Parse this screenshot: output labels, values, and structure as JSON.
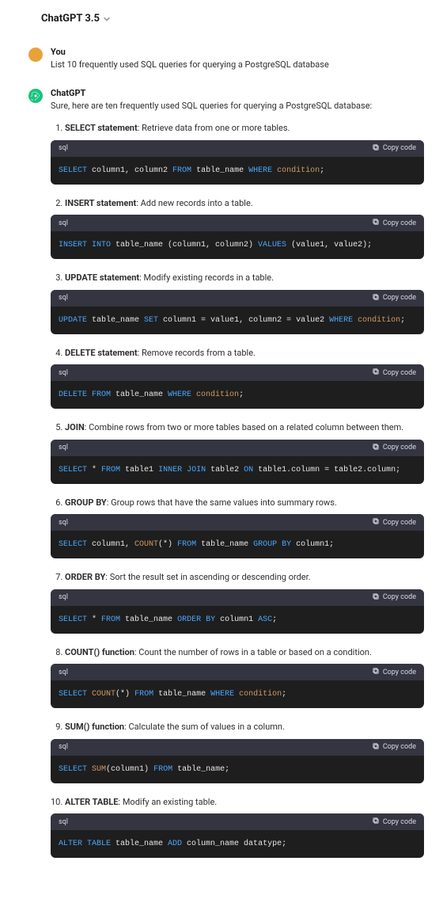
{
  "header": {
    "title": "ChatGPT 3.5"
  },
  "user": {
    "name": "You",
    "text": "List 10 frequently used SQL queries for querying a PostgreSQL database"
  },
  "bot": {
    "name": "ChatGPT",
    "intro": "Sure, here are ten frequently used SQL queries for querying a PostgreSQL database:"
  },
  "code_lang": "sql",
  "copy_label": "Copy code",
  "items": [
    {
      "title": "SELECT statement",
      "desc": ": Retrieve data from one or more tables.",
      "tokens": [
        {
          "t": "SELECT",
          "c": "kw"
        },
        {
          "t": " column1, column2 ",
          "c": "id"
        },
        {
          "t": "FROM",
          "c": "kw"
        },
        {
          "t": " table_name ",
          "c": "id"
        },
        {
          "t": "WHERE",
          "c": "kw"
        },
        {
          "t": " condition",
          "c": "fn"
        },
        {
          "t": ";",
          "c": "id"
        }
      ]
    },
    {
      "title": "INSERT statement",
      "desc": ": Add new records into a table.",
      "tokens": [
        {
          "t": "INSERT INTO",
          "c": "kw"
        },
        {
          "t": " table_name (column1, column2) ",
          "c": "id"
        },
        {
          "t": "VALUES",
          "c": "kw"
        },
        {
          "t": " (value1, value2);",
          "c": "id"
        }
      ]
    },
    {
      "title": "UPDATE statement",
      "desc": ": Modify existing records in a table.",
      "tokens": [
        {
          "t": "UPDATE",
          "c": "kw"
        },
        {
          "t": " table_name ",
          "c": "id"
        },
        {
          "t": "SET",
          "c": "kw"
        },
        {
          "t": " column1 = value1, column2 = value2 ",
          "c": "id"
        },
        {
          "t": "WHERE",
          "c": "kw"
        },
        {
          "t": " condition",
          "c": "fn"
        },
        {
          "t": ";",
          "c": "id"
        }
      ]
    },
    {
      "title": "DELETE statement",
      "desc": ": Remove records from a table.",
      "tokens": [
        {
          "t": "DELETE FROM",
          "c": "kw"
        },
        {
          "t": " table_name ",
          "c": "id"
        },
        {
          "t": "WHERE",
          "c": "kw"
        },
        {
          "t": " condition",
          "c": "fn"
        },
        {
          "t": ";",
          "c": "id"
        }
      ]
    },
    {
      "title": "JOIN",
      "desc": ": Combine rows from two or more tables based on a related column between them.",
      "tokens": [
        {
          "t": "SELECT",
          "c": "kw"
        },
        {
          "t": " * ",
          "c": "id"
        },
        {
          "t": "FROM",
          "c": "kw"
        },
        {
          "t": " table1 ",
          "c": "id"
        },
        {
          "t": "INNER JOIN",
          "c": "kw"
        },
        {
          "t": " table2 ",
          "c": "id"
        },
        {
          "t": "ON",
          "c": "kw"
        },
        {
          "t": " table1.column = table2.column;",
          "c": "id"
        }
      ]
    },
    {
      "title": "GROUP BY",
      "desc": ": Group rows that have the same values into summary rows.",
      "tokens": [
        {
          "t": "SELECT",
          "c": "kw"
        },
        {
          "t": " column1, ",
          "c": "id"
        },
        {
          "t": "COUNT",
          "c": "fn"
        },
        {
          "t": "(*) ",
          "c": "id"
        },
        {
          "t": "FROM",
          "c": "kw"
        },
        {
          "t": " table_name ",
          "c": "id"
        },
        {
          "t": "GROUP BY",
          "c": "kw"
        },
        {
          "t": " column1;",
          "c": "id"
        }
      ]
    },
    {
      "title": "ORDER BY",
      "desc": ": Sort the result set in ascending or descending order.",
      "tokens": [
        {
          "t": "SELECT",
          "c": "kw"
        },
        {
          "t": " * ",
          "c": "id"
        },
        {
          "t": "FROM",
          "c": "kw"
        },
        {
          "t": " table_name ",
          "c": "id"
        },
        {
          "t": "ORDER BY",
          "c": "kw"
        },
        {
          "t": " column1 ",
          "c": "id"
        },
        {
          "t": "ASC",
          "c": "kw"
        },
        {
          "t": ";",
          "c": "id"
        }
      ]
    },
    {
      "title": "COUNT() function",
      "desc": ": Count the number of rows in a table or based on a condition.",
      "tokens": [
        {
          "t": "SELECT",
          "c": "kw"
        },
        {
          "t": " ",
          "c": "id"
        },
        {
          "t": "COUNT",
          "c": "fn"
        },
        {
          "t": "(*) ",
          "c": "id"
        },
        {
          "t": "FROM",
          "c": "kw"
        },
        {
          "t": " table_name ",
          "c": "id"
        },
        {
          "t": "WHERE",
          "c": "kw"
        },
        {
          "t": " condition",
          "c": "fn"
        },
        {
          "t": ";",
          "c": "id"
        }
      ]
    },
    {
      "title": "SUM() function",
      "desc": ": Calculate the sum of values in a column.",
      "tokens": [
        {
          "t": "SELECT",
          "c": "kw"
        },
        {
          "t": " ",
          "c": "id"
        },
        {
          "t": "SUM",
          "c": "fn"
        },
        {
          "t": "(column1) ",
          "c": "id"
        },
        {
          "t": "FROM",
          "c": "kw"
        },
        {
          "t": " table_name;",
          "c": "id"
        }
      ]
    },
    {
      "title": "ALTER TABLE",
      "desc": ": Modify an existing table.",
      "tokens": [
        {
          "t": "ALTER TABLE",
          "c": "kw"
        },
        {
          "t": " table_name ",
          "c": "id"
        },
        {
          "t": "ADD",
          "c": "kw"
        },
        {
          "t": " column_name datatype;",
          "c": "id"
        }
      ]
    }
  ]
}
